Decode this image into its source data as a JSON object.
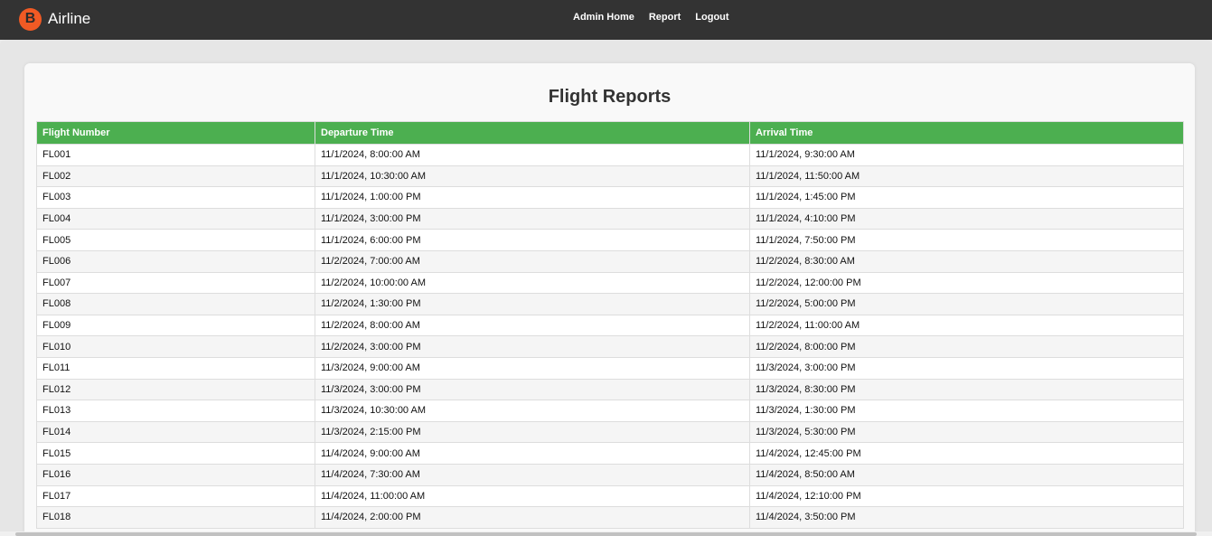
{
  "navbar": {
    "logo_letter": "B",
    "brand_name": "Airline",
    "brand_color": "#f15a24",
    "links": [
      "Admin Home",
      "Report",
      "Logout"
    ]
  },
  "page": {
    "title": "Flight Reports"
  },
  "table": {
    "header_color": "#4caf50",
    "columns": [
      "Flight Number",
      "Departure Time",
      "Arrival Time"
    ],
    "rows": [
      [
        "FL001",
        "11/1/2024, 8:00:00 AM",
        "11/1/2024, 9:30:00 AM"
      ],
      [
        "FL002",
        "11/1/2024, 10:30:00 AM",
        "11/1/2024, 11:50:00 AM"
      ],
      [
        "FL003",
        "11/1/2024, 1:00:00 PM",
        "11/1/2024, 1:45:00 PM"
      ],
      [
        "FL004",
        "11/1/2024, 3:00:00 PM",
        "11/1/2024, 4:10:00 PM"
      ],
      [
        "FL005",
        "11/1/2024, 6:00:00 PM",
        "11/1/2024, 7:50:00 PM"
      ],
      [
        "FL006",
        "11/2/2024, 7:00:00 AM",
        "11/2/2024, 8:30:00 AM"
      ],
      [
        "FL007",
        "11/2/2024, 10:00:00 AM",
        "11/2/2024, 12:00:00 PM"
      ],
      [
        "FL008",
        "11/2/2024, 1:30:00 PM",
        "11/2/2024, 5:00:00 PM"
      ],
      [
        "FL009",
        "11/2/2024, 8:00:00 AM",
        "11/2/2024, 11:00:00 AM"
      ],
      [
        "FL010",
        "11/2/2024, 3:00:00 PM",
        "11/2/2024, 8:00:00 PM"
      ],
      [
        "FL011",
        "11/3/2024, 9:00:00 AM",
        "11/3/2024, 3:00:00 PM"
      ],
      [
        "FL012",
        "11/3/2024, 3:00:00 PM",
        "11/3/2024, 8:30:00 PM"
      ],
      [
        "FL013",
        "11/3/2024, 10:30:00 AM",
        "11/3/2024, 1:30:00 PM"
      ],
      [
        "FL014",
        "11/3/2024, 2:15:00 PM",
        "11/3/2024, 5:30:00 PM"
      ],
      [
        "FL015",
        "11/4/2024, 9:00:00 AM",
        "11/4/2024, 12:45:00 PM"
      ],
      [
        "FL016",
        "11/4/2024, 7:30:00 AM",
        "11/4/2024, 8:50:00 AM"
      ],
      [
        "FL017",
        "11/4/2024, 11:00:00 AM",
        "11/4/2024, 12:10:00 PM"
      ],
      [
        "FL018",
        "11/4/2024, 2:00:00 PM",
        "11/4/2024, 3:50:00 PM"
      ]
    ]
  }
}
